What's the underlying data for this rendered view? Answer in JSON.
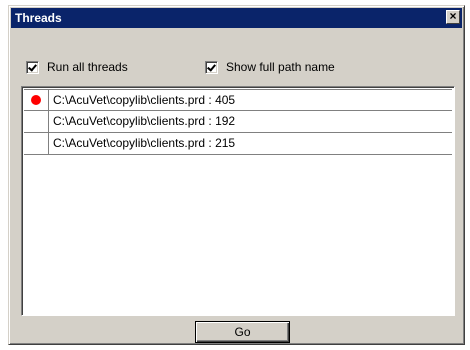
{
  "window": {
    "title": "Threads",
    "close_glyph": "×"
  },
  "options": {
    "run_all_threads": {
      "label": "Run all threads",
      "checked": true
    },
    "show_full_path": {
      "label": "Show full path name",
      "checked": true
    }
  },
  "threads": [
    {
      "text": "C:\\AcuVet\\copylib\\clients.prd : 405",
      "breakpoint": true,
      "marker_color": "#ff0000"
    },
    {
      "text": "C:\\AcuVet\\copylib\\clients.prd : 192",
      "breakpoint": false
    },
    {
      "text": "C:\\AcuVet\\copylib\\clients.prd : 215",
      "breakpoint": false
    }
  ],
  "actions": {
    "go_label": "Go"
  },
  "colors": {
    "titlebar": "#0a246a",
    "dialog_bg": "#d4d0c8"
  }
}
